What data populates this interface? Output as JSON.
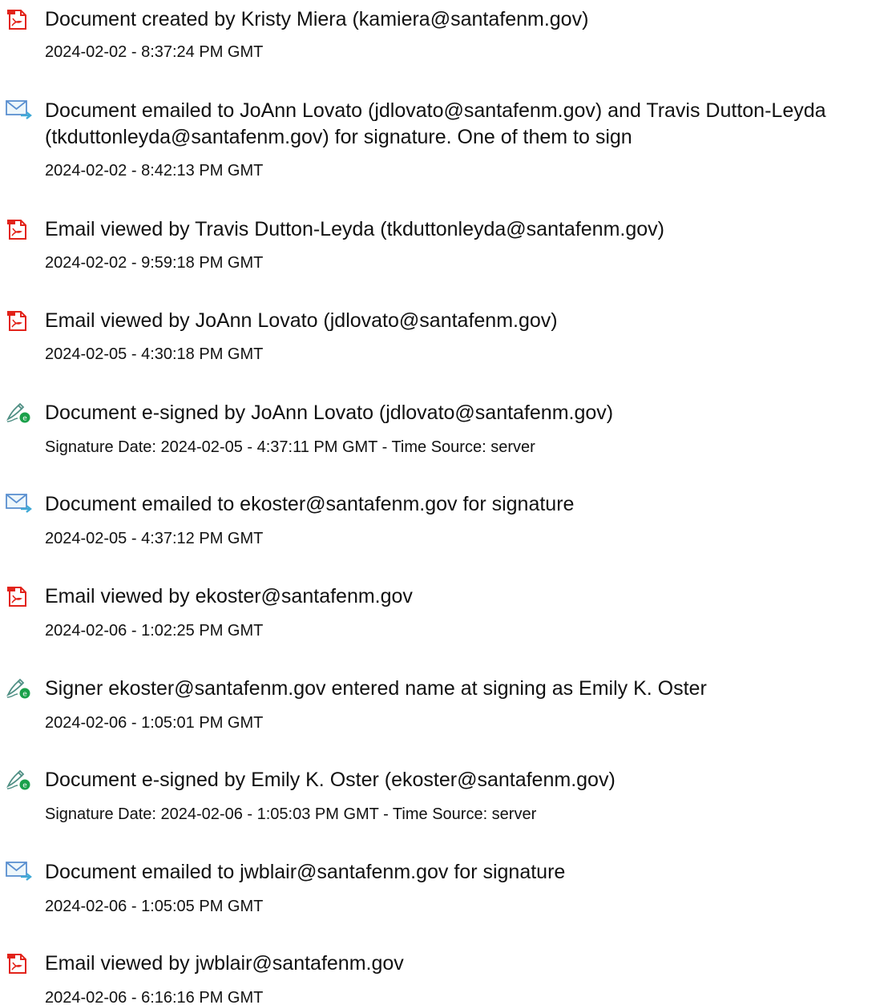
{
  "events": [
    {
      "icon": "document-created-icon",
      "title": "Document created by Kristy Miera (kamiera@santafenm.gov)",
      "meta": "2024-02-02 - 8:37:24 PM GMT"
    },
    {
      "icon": "email-sent-icon",
      "title": "Document emailed to JoAnn Lovato (jdlovato@santafenm.gov) and Travis Dutton-Leyda (tkduttonleyda@santafenm.gov) for signature. One of them to sign",
      "meta": "2024-02-02 - 8:42:13 PM GMT"
    },
    {
      "icon": "email-viewed-icon",
      "title": "Email viewed by Travis Dutton-Leyda (tkduttonleyda@santafenm.gov)",
      "meta": "2024-02-02 - 9:59:18 PM GMT"
    },
    {
      "icon": "email-viewed-icon",
      "title": "Email viewed by JoAnn Lovato (jdlovato@santafenm.gov)",
      "meta": "2024-02-05 - 4:30:18 PM GMT"
    },
    {
      "icon": "e-signed-icon",
      "title": "Document e-signed by JoAnn Lovato (jdlovato@santafenm.gov)",
      "meta": "Signature Date: 2024-02-05 - 4:37:11 PM GMT - Time Source: server"
    },
    {
      "icon": "email-sent-icon",
      "title": "Document emailed to ekoster@santafenm.gov for signature",
      "meta": "2024-02-05 - 4:37:12 PM GMT"
    },
    {
      "icon": "email-viewed-icon",
      "title": "Email viewed by ekoster@santafenm.gov",
      "meta": "2024-02-06 - 1:02:25 PM GMT"
    },
    {
      "icon": "e-signed-icon",
      "title": "Signer ekoster@santafenm.gov entered name at signing as Emily K. Oster",
      "meta": "2024-02-06 - 1:05:01 PM GMT"
    },
    {
      "icon": "e-signed-icon",
      "title": "Document e-signed by Emily K. Oster (ekoster@santafenm.gov)",
      "meta": "Signature Date: 2024-02-06 - 1:05:03 PM GMT - Time Source: server"
    },
    {
      "icon": "email-sent-icon",
      "title": "Document emailed to jwblair@santafenm.gov for signature",
      "meta": "2024-02-06 - 1:05:05 PM GMT"
    },
    {
      "icon": "email-viewed-icon",
      "title": "Email viewed by jwblair@santafenm.gov",
      "meta": "2024-02-06 - 6:16:16 PM GMT"
    }
  ]
}
